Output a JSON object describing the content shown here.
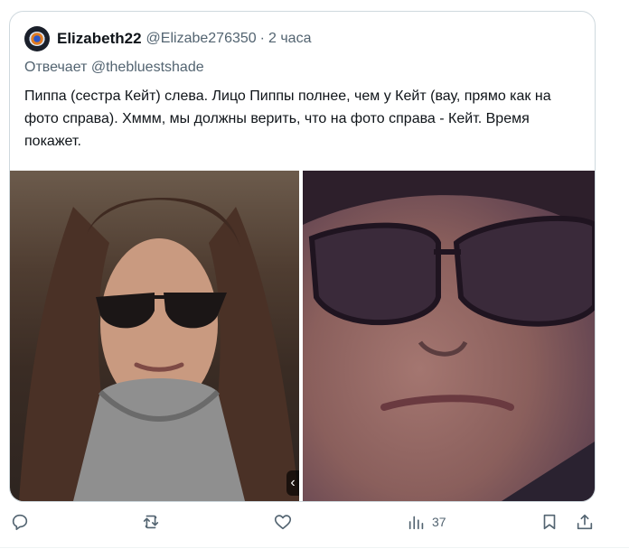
{
  "tweet": {
    "author_name": "Elizabeth22",
    "author_handle": "@Elizabe276350",
    "separator": "·",
    "time": "2 часа",
    "reply_label": "Отвечает",
    "reply_to": "@thebluestshade",
    "text": "Пиппа (сестра Кейт) слева. Лицо Пиппы полнее, чем у Кейт (вау, прямо как на фото справа). Хммм, мы должны верить, что на фото справа - Кейт. Время покажет."
  },
  "media": {
    "badge_glyph": "‹"
  },
  "actions": {
    "views_count": "37",
    "icons": [
      "reply-icon",
      "retweet-icon",
      "like-icon",
      "views-icon",
      "bookmark-icon",
      "share-icon"
    ]
  },
  "colors": {
    "text_primary": "#0f1419",
    "text_secondary": "#536471",
    "border": "#cfd9de"
  }
}
